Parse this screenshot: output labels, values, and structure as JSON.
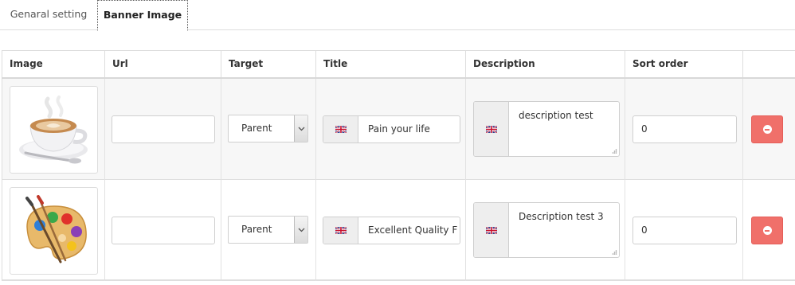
{
  "tabs": [
    {
      "label": "Genaral setting",
      "active": false
    },
    {
      "label": "Banner Image",
      "active": true
    }
  ],
  "table": {
    "headers": [
      "Image",
      "Url",
      "Target",
      "Title",
      "Description",
      "Sort order",
      ""
    ],
    "rows": [
      {
        "image_icon": "coffee-cup-image",
        "url": "",
        "target": "Parent",
        "title": "Pain your life",
        "description": "description test",
        "sort_order": "0",
        "flag_icon": "uk-flag-icon",
        "action_icon": "minus-circle-icon"
      },
      {
        "image_icon": "paint-palette-image",
        "url": "",
        "target": "Parent",
        "title": "Excellent Quality F",
        "description": "Description test 3",
        "sort_order": "0",
        "flag_icon": "uk-flag-icon",
        "action_icon": "minus-circle-icon"
      }
    ]
  },
  "colors": {
    "remove_button": "#f0706a",
    "row_stripe": "#f7f7f7",
    "border": "#cfcfcf"
  }
}
